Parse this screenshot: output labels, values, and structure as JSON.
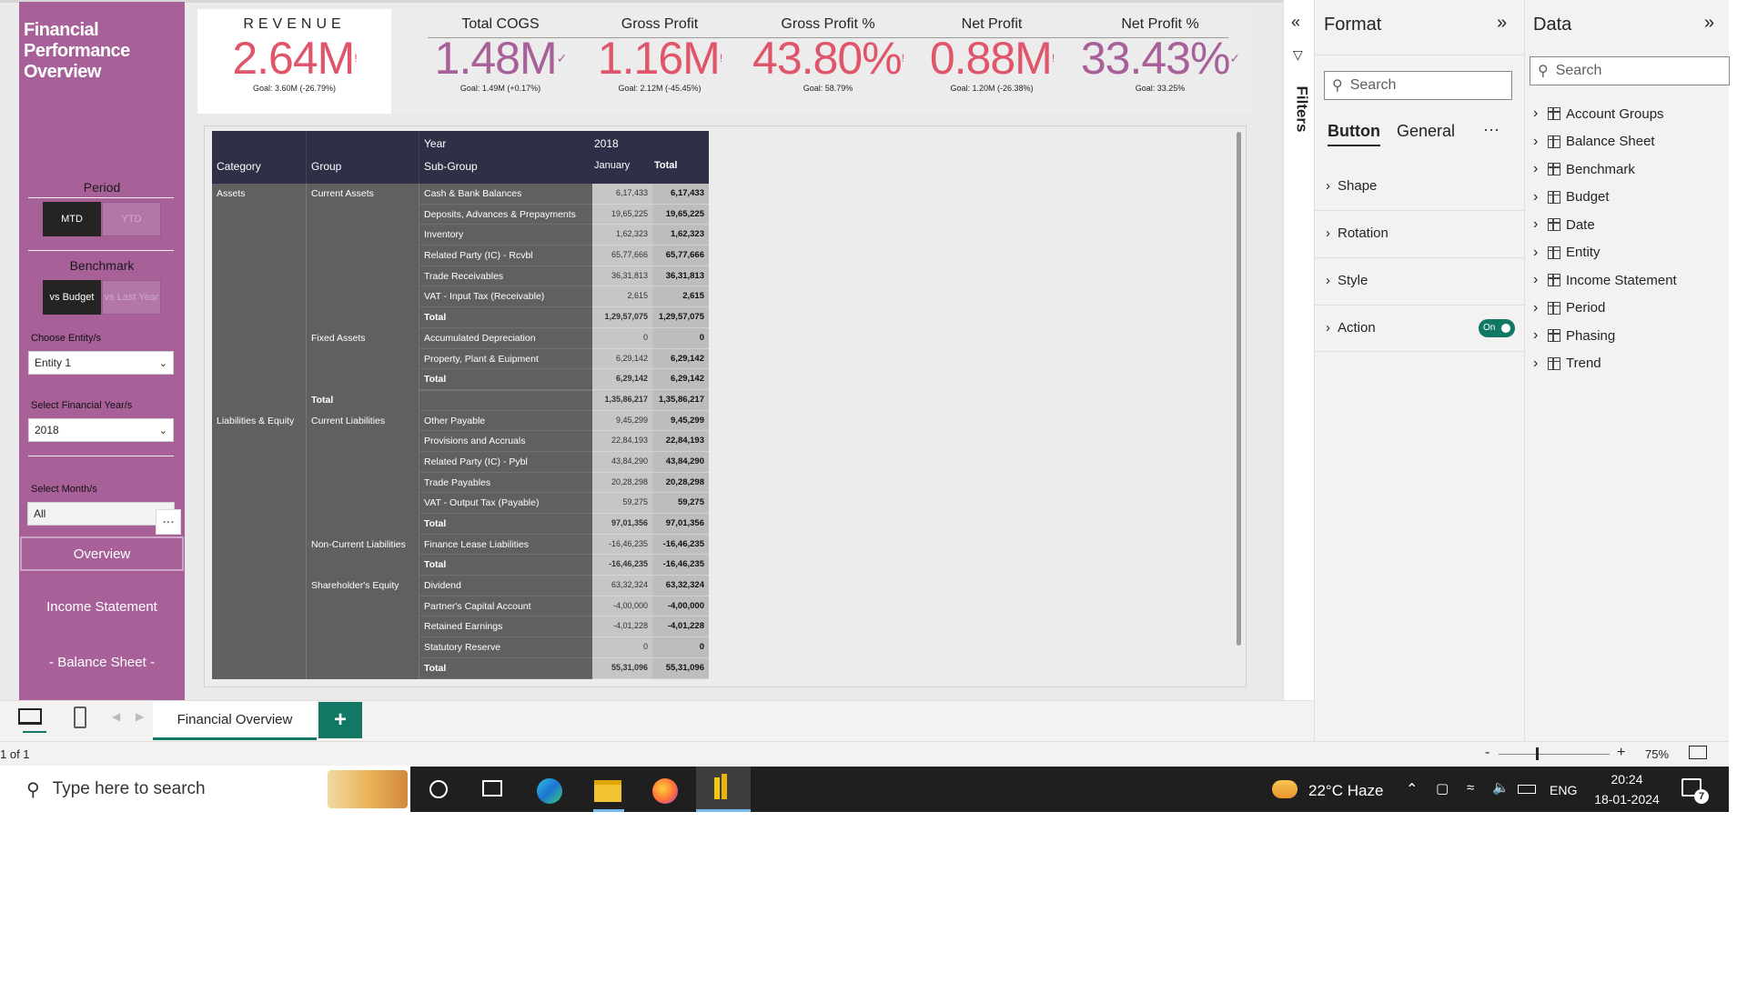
{
  "report": {
    "title_line1": "Financial",
    "title_line2": "Performance",
    "title_line3": "Overview",
    "period_label": "Period",
    "period_options": [
      "MTD",
      "YTD"
    ],
    "benchmark_label": "Benchmark",
    "benchmark_options": [
      "vs Budget",
      "vs Last Year"
    ],
    "entity_label": "Choose Entity/s",
    "entity_value": "Entity 1",
    "year_label": "Select Financial Year/s",
    "year_value": "2018",
    "month_label": "Select Month/s",
    "month_value": "All",
    "more_label": "...",
    "nav": [
      "Overview",
      "Income Statement",
      "- Balance Sheet -"
    ]
  },
  "kpis": [
    {
      "title": "REVENUE",
      "value": "2.64M",
      "mark": "!",
      "goal": "Goal: 3.60M (-26.79%)",
      "color": "#e0556a"
    },
    {
      "title": "Total COGS",
      "value": "1.48M",
      "mark": "✓",
      "goal": "Goal: 1.49M (+0.17%)",
      "color": "#a86099"
    },
    {
      "title": "Gross Profit",
      "value": "1.16M",
      "mark": "!",
      "goal": "Goal: 2.12M (-45.45%)",
      "color": "#e0556a"
    },
    {
      "title": "Gross Profit %",
      "value": "43.80%",
      "mark": "!",
      "goal": "Goal: 58.79%",
      "color": "#e0556a"
    },
    {
      "title": "Net Profit",
      "value": "0.88M",
      "mark": "!",
      "goal": "Goal: 1.20M (-26.38%)",
      "color": "#e0556a"
    },
    {
      "title": "Net Profit %",
      "value": "33.43%",
      "mark": "✓",
      "goal": "Goal: 33.25%",
      "color": "#a86099"
    }
  ],
  "matrix": {
    "headers": {
      "year": "Year",
      "year_value": "2018",
      "category": "Category",
      "group": "Group",
      "subgroup": "Sub-Group",
      "month": "January",
      "total": "Total"
    },
    "rows": [
      {
        "cat": "Assets",
        "group": "Current Assets",
        "sub": "Cash & Bank Balances",
        "v1": "6,17,433",
        "v2": "6,17,433"
      },
      {
        "cat": "",
        "group": "",
        "sub": "Deposits, Advances & Prepayments",
        "v1": "19,65,225",
        "v2": "19,65,225"
      },
      {
        "cat": "",
        "group": "",
        "sub": "Inventory",
        "v1": "1,62,323",
        "v2": "1,62,323"
      },
      {
        "cat": "",
        "group": "",
        "sub": "Related Party (IC) - Rcvbl",
        "v1": "65,77,666",
        "v2": "65,77,666"
      },
      {
        "cat": "",
        "group": "",
        "sub": "Trade Receivables",
        "v1": "36,31,813",
        "v2": "36,31,813"
      },
      {
        "cat": "",
        "group": "",
        "sub": "VAT - Input Tax (Receivable)",
        "v1": "2,615",
        "v2": "2,615"
      },
      {
        "cat": "",
        "group": "",
        "sub": "Total",
        "v1": "1,29,57,075",
        "v2": "1,29,57,075",
        "total": true
      },
      {
        "cat": "",
        "group": "Fixed Assets",
        "sub": "Accumulated Depreciation",
        "v1": "0",
        "v2": "0"
      },
      {
        "cat": "",
        "group": "",
        "sub": "Property, Plant & Euipment",
        "v1": "6,29,142",
        "v2": "6,29,142"
      },
      {
        "cat": "",
        "group": "",
        "sub": "Total",
        "v1": "6,29,142",
        "v2": "6,29,142",
        "total": true
      },
      {
        "cat": "",
        "group": "Total",
        "sub": "",
        "v1": "1,35,86,217",
        "v2": "1,35,86,217",
        "total": true,
        "grouptotal": true
      },
      {
        "cat": "Liabilities & Equity",
        "group": "Current Liabilities",
        "sub": "Other Payable",
        "v1": "9,45,299",
        "v2": "9,45,299"
      },
      {
        "cat": "",
        "group": "",
        "sub": "Provisions and Accruals",
        "v1": "22,84,193",
        "v2": "22,84,193"
      },
      {
        "cat": "",
        "group": "",
        "sub": "Related Party (IC) - Pybl",
        "v1": "43,84,290",
        "v2": "43,84,290"
      },
      {
        "cat": "",
        "group": "",
        "sub": "Trade Payables",
        "v1": "20,28,298",
        "v2": "20,28,298"
      },
      {
        "cat": "",
        "group": "",
        "sub": "VAT - Output Tax (Payable)",
        "v1": "59,275",
        "v2": "59,275"
      },
      {
        "cat": "",
        "group": "",
        "sub": "Total",
        "v1": "97,01,356",
        "v2": "97,01,356",
        "total": true
      },
      {
        "cat": "",
        "group": "Non-Current Liabilities",
        "sub": "Finance Lease Liabilities",
        "v1": "-16,46,235",
        "v2": "-16,46,235"
      },
      {
        "cat": "",
        "group": "",
        "sub": "Total",
        "v1": "-16,46,235",
        "v2": "-16,46,235",
        "total": true
      },
      {
        "cat": "",
        "group": "Shareholder's Equity",
        "sub": "Dividend",
        "v1": "63,32,324",
        "v2": "63,32,324"
      },
      {
        "cat": "",
        "group": "",
        "sub": "Partner's Capital Account",
        "v1": "-4,00,000",
        "v2": "-4,00,000"
      },
      {
        "cat": "",
        "group": "",
        "sub": "Retained Earnings",
        "v1": "-4,01,228",
        "v2": "-4,01,228"
      },
      {
        "cat": "",
        "group": "",
        "sub": "Statutory Reserve",
        "v1": "0",
        "v2": "0"
      },
      {
        "cat": "",
        "group": "",
        "sub": "Total",
        "v1": "55,31,096",
        "v2": "55,31,096",
        "total": true
      }
    ]
  },
  "filters_pane": {
    "label": "Filters"
  },
  "format_pane": {
    "title": "Format",
    "search_placeholder": "Search",
    "tabs": [
      "Button",
      "General"
    ],
    "more": "···",
    "sections": [
      "Shape",
      "Rotation",
      "Style",
      "Action"
    ],
    "action_toggle": "On"
  },
  "data_pane": {
    "title": "Data",
    "search_placeholder": "Search",
    "tables": [
      "Account Groups",
      "Balance Sheet",
      "Benchmark",
      "Budget",
      "Date",
      "Entity",
      "Income Statement",
      "Period",
      "Phasing",
      "Trend"
    ]
  },
  "tabs": {
    "page_tab": "Financial Overview",
    "add": "+"
  },
  "status": {
    "page": "1 of 1",
    "zoom": "75%",
    "minus": "-",
    "plus": "+"
  },
  "taskbar": {
    "search_placeholder": "Type here to search",
    "weather": "22°C  Haze",
    "lang": "ENG",
    "time": "20:24",
    "date": "18-01-2024",
    "notif_count": "7"
  },
  "colors": {
    "sidebar": "#a86099",
    "bad": "#e0556a",
    "good": "#a86099",
    "matrix_head": "#2f2f48",
    "toggle": "#117865"
  }
}
